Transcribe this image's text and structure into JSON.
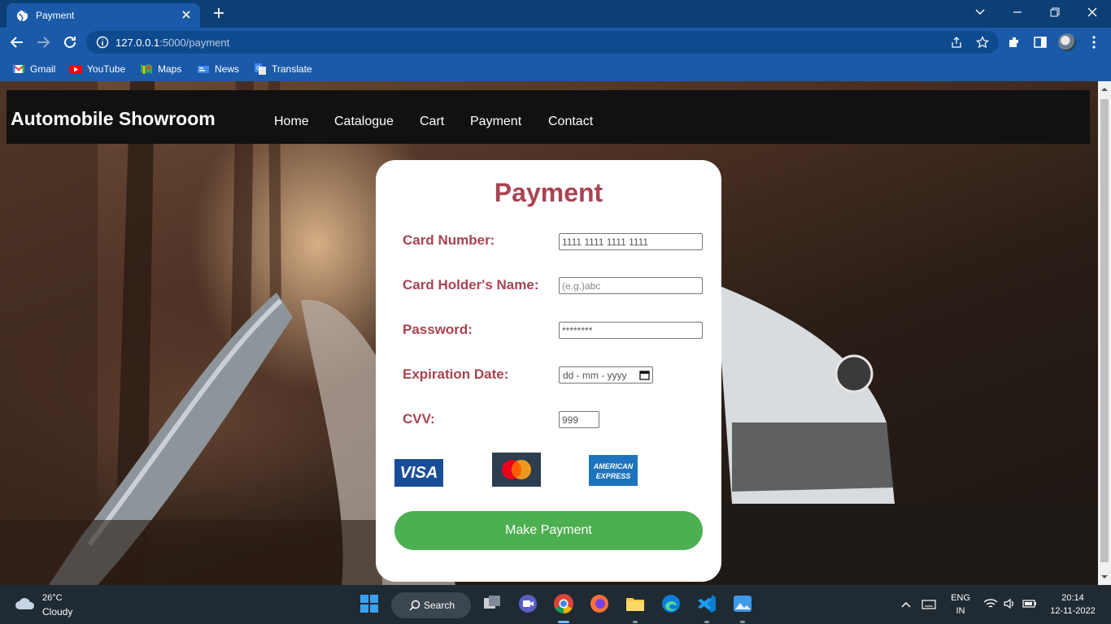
{
  "browser": {
    "tab_title": "Payment",
    "url_host": "127.0.0.1",
    "url_path": ":5000/payment",
    "bookmarks": [
      "Gmail",
      "YouTube",
      "Maps",
      "News",
      "Translate"
    ]
  },
  "site": {
    "brand": "Automobile Showroom",
    "nav": [
      "Home",
      "Catalogue",
      "Cart",
      "Payment",
      "Contact"
    ]
  },
  "form": {
    "title": "Payment",
    "card_number_label": "Card Number:",
    "card_number_value": "1111 1111 1111 1111",
    "holder_label": "Card Holder's Name:",
    "holder_placeholder": "(e.g.)abc",
    "password_label": "Password:",
    "password_value": "********",
    "expiry_label": "Expiration Date:",
    "expiry_placeholder": "dd - mm - yyyy",
    "cvv_label": "CVV:",
    "cvv_value": "999",
    "cards": [
      "VISA",
      "Mastercard",
      "American Express"
    ],
    "visa_text": "VISA",
    "amex_text_1": "AMERICAN",
    "amex_text_2": "EXPRESS",
    "submit_label": "Make Payment"
  },
  "taskbar": {
    "temperature": "26°C",
    "weather": "Cloudy",
    "search_label": "Search",
    "lang_1": "ENG",
    "lang_2": "IN",
    "time": "20:14",
    "date": "12-11-2022"
  },
  "colors": {
    "accent": "#a84452",
    "button": "#4caf50",
    "navbar": "#111111",
    "chrome": "#1a5aa8"
  }
}
